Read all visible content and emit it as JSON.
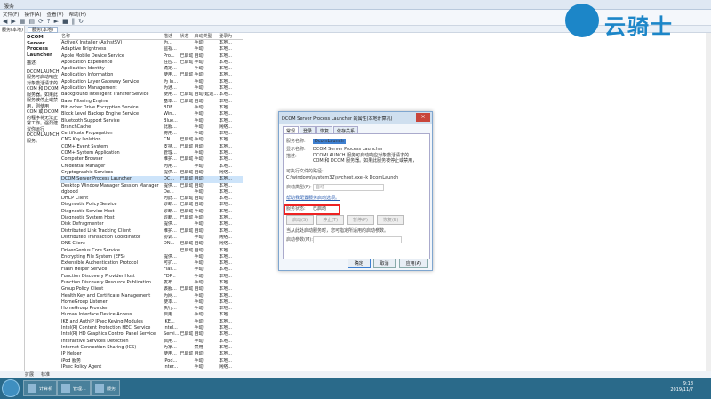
{
  "window": {
    "title": "服务"
  },
  "menu": [
    "文件(F)",
    "操作(A)",
    "查看(V)",
    "帮助(H)"
  ],
  "toolbar": {
    "icons": [
      "back-icon",
      "forward-icon",
      "tree-icon",
      "properties-icon",
      "refresh-icon",
      "help-icon",
      "play-icon",
      "stop-icon",
      "pause-icon",
      "restart-icon"
    ]
  },
  "tree": {
    "items": [
      "服务(本地)"
    ]
  },
  "pane": {
    "tab": "服务(本地)"
  },
  "desc": {
    "title": "DCOM Server Process Launcher",
    "desc_label": "描述:",
    "desc_text": "DCOMLAUNCH 服务可启动响应对象激活请求的 COM 和 DCOM 服务器。如果此服务被停止或禁用，则使用 COM 或 DCOM 的程序将无法正常工作。强烈建议你运行 DCOMLAUNCH 服务。"
  },
  "table": {
    "headers": [
      "名称",
      "描述",
      "状态",
      "启动类型",
      "登录为"
    ],
    "rows": [
      [
        "ActiveX Installer (AxInstSV)",
        "为...",
        "",
        "手动",
        "本地..."
      ],
      [
        "Adaptive Brightness",
        "监视...",
        "",
        "手动",
        "本地..."
      ],
      [
        "Apple Mobile Device Service",
        "Pro...",
        "已启动",
        "自动",
        "本地..."
      ],
      [
        "Application Experience",
        "在应...",
        "已启动",
        "手动",
        "本地..."
      ],
      [
        "Application Identity",
        "确定...",
        "",
        "手动",
        "本地..."
      ],
      [
        "Application Information",
        "使用...",
        "已启动",
        "手动",
        "本地..."
      ],
      [
        "Application Layer Gateway Service",
        "为 In...",
        "",
        "手动",
        "本地..."
      ],
      [
        "Application Management",
        "为通...",
        "",
        "手动",
        "本地..."
      ],
      [
        "Background Intelligent Transfer Service",
        "使用...",
        "已启动",
        "自动(延迟...",
        "本地..."
      ],
      [
        "Base Filtering Engine",
        "基本...",
        "已启动",
        "自动",
        "本地..."
      ],
      [
        "BitLocker Drive Encryption Service",
        "BDE...",
        "",
        "手动",
        "本地..."
      ],
      [
        "Block Level Backup Engine Service",
        "Win...",
        "",
        "手动",
        "本地..."
      ],
      [
        "Bluetooth Support Service",
        "Blue...",
        "",
        "手动",
        "本地..."
      ],
      [
        "BranchCache",
        "此服...",
        "",
        "手动",
        "网络..."
      ],
      [
        "Certificate Propagation",
        "将用...",
        "",
        "手动",
        "本地..."
      ],
      [
        "CNG Key Isolation",
        "CN...",
        "已启动",
        "手动",
        "本地..."
      ],
      [
        "COM+ Event System",
        "支持...",
        "已启动",
        "自动",
        "本地..."
      ],
      [
        "COM+ System Application",
        "管理...",
        "",
        "手动",
        "本地..."
      ],
      [
        "Computer Browser",
        "维护...",
        "已启动",
        "手动",
        "本地..."
      ],
      [
        "Credential Manager",
        "为用...",
        "",
        "手动",
        "本地..."
      ],
      [
        "Cryptographic Services",
        "提供...",
        "已启动",
        "自动",
        "网络..."
      ],
      [
        "DCOM Server Process Launcher",
        "DC...",
        "已启动",
        "自动",
        "本地..."
      ],
      [
        "Desktop Window Manager Session Manager",
        "提供...",
        "已启动",
        "自动",
        "本地..."
      ],
      [
        "dgbood",
        "De...",
        "",
        "手动",
        "本地..."
      ],
      [
        "DHCP Client",
        "为此...",
        "已启动",
        "自动",
        "本地..."
      ],
      [
        "Diagnostic Policy Service",
        "诊断...",
        "已启动",
        "自动",
        "本地..."
      ],
      [
        "Diagnostic Service Host",
        "诊断...",
        "已启动",
        "手动",
        "本地..."
      ],
      [
        "Diagnostic System Host",
        "诊断...",
        "已启动",
        "手动",
        "本地..."
      ],
      [
        "Disk Defragmenter",
        "提供...",
        "",
        "手动",
        "本地..."
      ],
      [
        "Distributed Link Tracking Client",
        "维护...",
        "已启动",
        "自动",
        "本地..."
      ],
      [
        "Distributed Transaction Coordinator",
        "协调...",
        "",
        "手动",
        "网络..."
      ],
      [
        "DNS Client",
        "DN...",
        "已启动",
        "自动",
        "网络..."
      ],
      [
        "DriverGenius Core Service",
        "",
        "已启动",
        "自动",
        "本地..."
      ],
      [
        "Encrypting File System (EFS)",
        "提供...",
        "",
        "手动",
        "本地..."
      ],
      [
        "Extensible Authentication Protocol",
        "可扩...",
        "",
        "手动",
        "本地..."
      ],
      [
        "Flash Helper Service",
        "Flas...",
        "",
        "手动",
        "本地..."
      ],
      [
        "Function Discovery Provider Host",
        "FDP...",
        "",
        "手动",
        "本地..."
      ],
      [
        "Function Discovery Resource Publication",
        "发布...",
        "",
        "手动",
        "本地..."
      ],
      [
        "Group Policy Client",
        "该服...",
        "已启动",
        "自动",
        "本地..."
      ],
      [
        "Health Key and Certificate Management",
        "为网...",
        "",
        "手动",
        "本地..."
      ],
      [
        "HomeGroup Listener",
        "使本...",
        "",
        "手动",
        "本地..."
      ],
      [
        "HomeGroup Provider",
        "执行...",
        "",
        "手动",
        "本地..."
      ],
      [
        "Human Interface Device Access",
        "启用...",
        "",
        "手动",
        "本地..."
      ],
      [
        "IKE and AuthIP IPsec Keying Modules",
        "IKE...",
        "",
        "手动",
        "本地..."
      ],
      [
        "Intel(R) Content Protection HECI Service",
        "Intel...",
        "",
        "手动",
        "本地..."
      ],
      [
        "Intel(R) HD Graphics Control Panel Service",
        "Servi...",
        "已启动",
        "自动",
        "本地..."
      ],
      [
        "Interactive Services Detection",
        "启用...",
        "",
        "手动",
        "本地..."
      ],
      [
        "Internet Connection Sharing (ICS)",
        "为家...",
        "",
        "禁用",
        "本地..."
      ],
      [
        "IP Helper",
        "使用...",
        "已启动",
        "自动",
        "本地..."
      ],
      [
        "iPod 服务",
        "iPod...",
        "",
        "手动",
        "本地..."
      ],
      [
        "IPsec Policy Agent",
        "Inter...",
        "",
        "手动",
        "网络..."
      ]
    ],
    "selected_index": 21
  },
  "statusbar": {
    "tabs": [
      "扩展",
      "标准"
    ]
  },
  "dialog": {
    "title": "DCOM Server Process Launcher 的属性(本地计算机)",
    "close": "×",
    "tabs": [
      "常规",
      "登录",
      "恢复",
      "依存关系"
    ],
    "service_name_label": "服务名称:",
    "service_name": "DcomLaunch",
    "display_name_label": "显示名称:",
    "display_name": "DCOM Server Process Launcher",
    "desc_label": "描述:",
    "desc_text": "DCOMLAUNCH 服务可启动响应对象激活请求的 COM 和 DCOM 服务器。如果此服务被停止或禁用，",
    "path_label": "可执行文件的路径:",
    "path": "C:\\windows\\system32\\svchost.exe -k DcomLaunch",
    "startup_label": "启动类型(E):",
    "startup_value": "自动",
    "help_link": "帮助我配置服务启动选项。",
    "status_label": "服务状态:",
    "status_value": "已启动",
    "btn_start": "启动(S)",
    "btn_stop": "停止(T)",
    "btn_pause": "暂停(P)",
    "btn_resume": "恢复(R)",
    "note": "当从此处启动服务时，您可指定所适用的启动参数。",
    "params_label": "启动参数(M):",
    "ok": "确定",
    "cancel": "取消",
    "apply": "应用(A)"
  },
  "taskbar": {
    "items": [
      "计算机",
      "管理...",
      "服务"
    ],
    "time": "9:18",
    "date": "2019/11/7"
  },
  "watermark": {
    "text": "云骑士"
  }
}
